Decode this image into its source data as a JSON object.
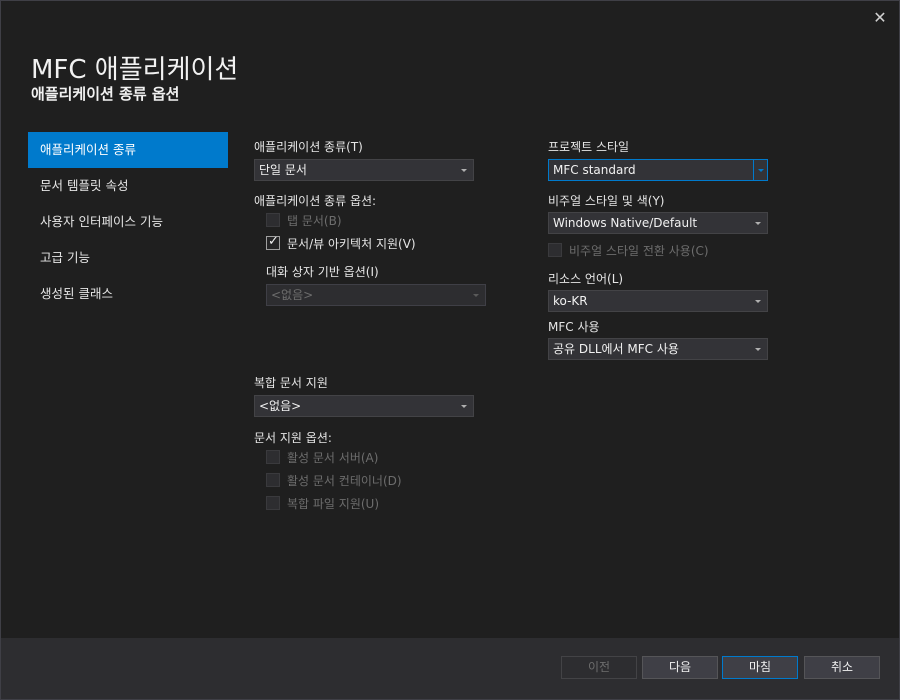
{
  "window": {
    "title": "MFC 애플리케이션",
    "subtitle": "애플리케이션 종류 옵션",
    "close_glyph": "✕"
  },
  "nav": {
    "items": [
      {
        "label": "애플리케이션 종류",
        "active": true
      },
      {
        "label": "문서 템플릿 속성"
      },
      {
        "label": "사용자 인터페이스 기능"
      },
      {
        "label": "고급 기능"
      },
      {
        "label": "생성된 클래스"
      }
    ]
  },
  "app_type": {
    "label": "애플리케이션 종류(T)",
    "value": "단일 문서",
    "options_label": "애플리케이션 종류 옵션:",
    "tabbed_docs": {
      "label": "탭 문서(B)",
      "checked": false,
      "enabled": false
    },
    "doc_view": {
      "label": "문서/뷰 아키텍처 지원(V)",
      "checked": true,
      "enabled": true
    },
    "dialog_options_label": "대화 상자 기반 옵션(I)",
    "dialog_options_value": "<없음>"
  },
  "compound": {
    "label": "복합 문서 지원",
    "value": "<없음>",
    "options_label": "문서 지원 옵션:",
    "active_server": {
      "label": "활성 문서 서버(A)",
      "checked": false,
      "enabled": false
    },
    "active_container": {
      "label": "활성 문서 컨테이너(D)",
      "checked": false,
      "enabled": false
    },
    "compound_file": {
      "label": "복합 파일 지원(U)",
      "checked": false,
      "enabled": false
    }
  },
  "project_style": {
    "label": "프로젝트 스타일",
    "value": "MFC standard",
    "visual_label": "비주얼 스타일 및 색(Y)",
    "visual_value": "Windows Native/Default",
    "visual_switch": {
      "label": "비주얼 스타일 전환 사용(C)",
      "checked": false,
      "enabled": false
    },
    "resource_label": "리소스 언어(L)",
    "resource_value": "ko-KR",
    "mfc_use_label": "MFC 사용",
    "mfc_use_value": "공유 DLL에서 MFC 사용"
  },
  "footer": {
    "prev": "이전",
    "next": "다음",
    "finish": "마침",
    "cancel": "취소"
  },
  "colors": {
    "accent": "#007acc",
    "background": "#1f1f1f",
    "footer": "#2d2d30"
  },
  "icons": {
    "close": "close-icon",
    "checkmark": "checkmark-icon",
    "dropdown": "chevron-down-icon"
  }
}
